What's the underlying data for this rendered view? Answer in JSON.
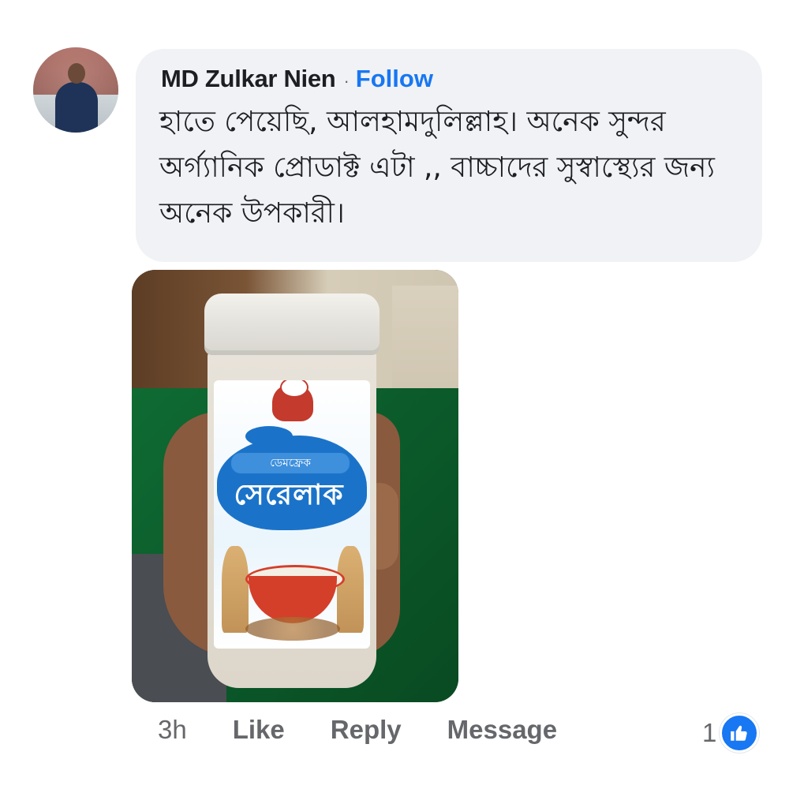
{
  "comment": {
    "author": "MD Zulkar Nien",
    "separator": "·",
    "follow_label": "Follow",
    "text": "হাতে পেয়েছি, আলহামদুলিল্লাহ। অনেক সুন্দর অর্গ্যানিক প্রোডাক্ট এটা ,, বাচ্চাদের সুস্বাস্থ্যের জন্য অনেক উপকারী।"
  },
  "photo": {
    "brand_small": "ডেমফ্রেক",
    "brand_big": "সেরেলাক"
  },
  "actions": {
    "time": "3h",
    "like_label": "Like",
    "reply_label": "Reply",
    "message_label": "Message"
  },
  "reactions": {
    "count": "1",
    "icon": "thumbs-up-icon",
    "color": "#1877f2"
  }
}
